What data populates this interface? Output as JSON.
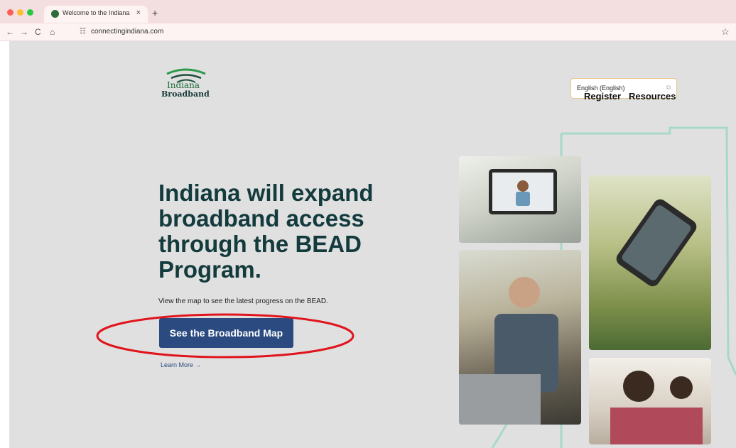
{
  "browser": {
    "tab_title": "Welcome to the Indiana Broa",
    "tab_close": "×",
    "new_tab": "+",
    "url": "connectingindiana.com",
    "back": "←",
    "forward": "→",
    "reload": "C",
    "home": "⌂",
    "site_info": "☷",
    "bookmark": "☆"
  },
  "header": {
    "logo_line1": "Indiana",
    "logo_line2": "Broadband",
    "language": "English (English)",
    "nav": [
      "Register",
      "Resources"
    ]
  },
  "hero": {
    "headline": "Indiana will expand broadband access through the BEAD Program.",
    "subtext": "View the map to see the latest progress on the BEAD.",
    "cta": "See the Broadband Map",
    "learn_more": "Learn More →"
  },
  "colors": {
    "accent_button": "#2a4a80",
    "headline": "#133a3c",
    "annotation": "#e0141c",
    "logo_green": "#2c9a4a"
  }
}
